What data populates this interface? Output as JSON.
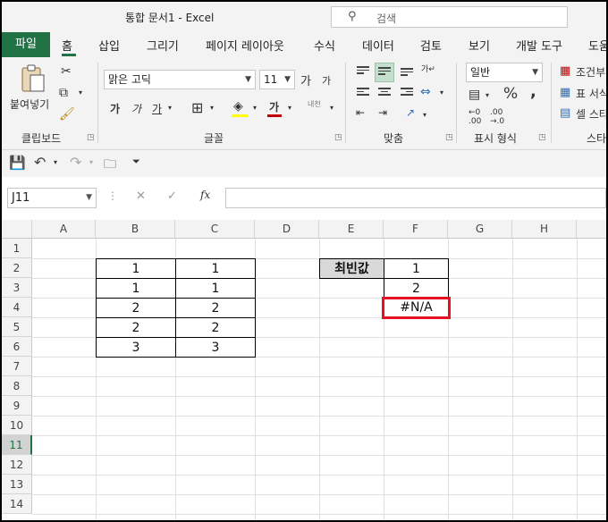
{
  "window": {
    "title": "통합 문서1  -  Excel",
    "search_placeholder": "검색"
  },
  "tabs": [
    "파일",
    "홈",
    "삽입",
    "그리기",
    "페이지 레이아웃",
    "수식",
    "데이터",
    "검토",
    "보기",
    "개발 도구",
    "도움"
  ],
  "active_tab": "홈",
  "colors": {
    "accent": "#217346",
    "highlight": "#e81123",
    "font_underline": "#c00000"
  },
  "ribbon": {
    "clipboard": {
      "label": "클립보드",
      "paste": "붙여넣기"
    },
    "font": {
      "label": "글꼴",
      "font_name": "맑은 고딕",
      "font_size": "11",
      "grow": "가",
      "shrink": "가",
      "bold": "가",
      "italic": "가",
      "underline": "가",
      "font_color_glyph": "가",
      "phonetic": "내천"
    },
    "alignment": {
      "label": "맞춤"
    },
    "number": {
      "label": "표시 형식",
      "format": "일반",
      "percent": "%",
      "comma": ","
    },
    "styles": {
      "label": "스타",
      "conditional": "조건부",
      "table": "표 서식",
      "cell": "셀 스타"
    }
  },
  "formula_bar": {
    "name_box": "J11",
    "fx": "fx",
    "formula": ""
  },
  "grid": {
    "columns": [
      "A",
      "B",
      "C",
      "D",
      "E",
      "F",
      "G",
      "H"
    ],
    "rows": [
      "1",
      "2",
      "3",
      "4",
      "5",
      "6",
      "7",
      "8",
      "9",
      "10",
      "11",
      "12",
      "13",
      "14"
    ],
    "selected_row": "11",
    "table_bc": [
      [
        "1",
        "1"
      ],
      [
        "1",
        "1"
      ],
      [
        "2",
        "2"
      ],
      [
        "2",
        "2"
      ],
      [
        "3",
        "3"
      ]
    ],
    "label_e2": "최빈값",
    "f_values": [
      "1",
      "2",
      "#N/A"
    ]
  }
}
